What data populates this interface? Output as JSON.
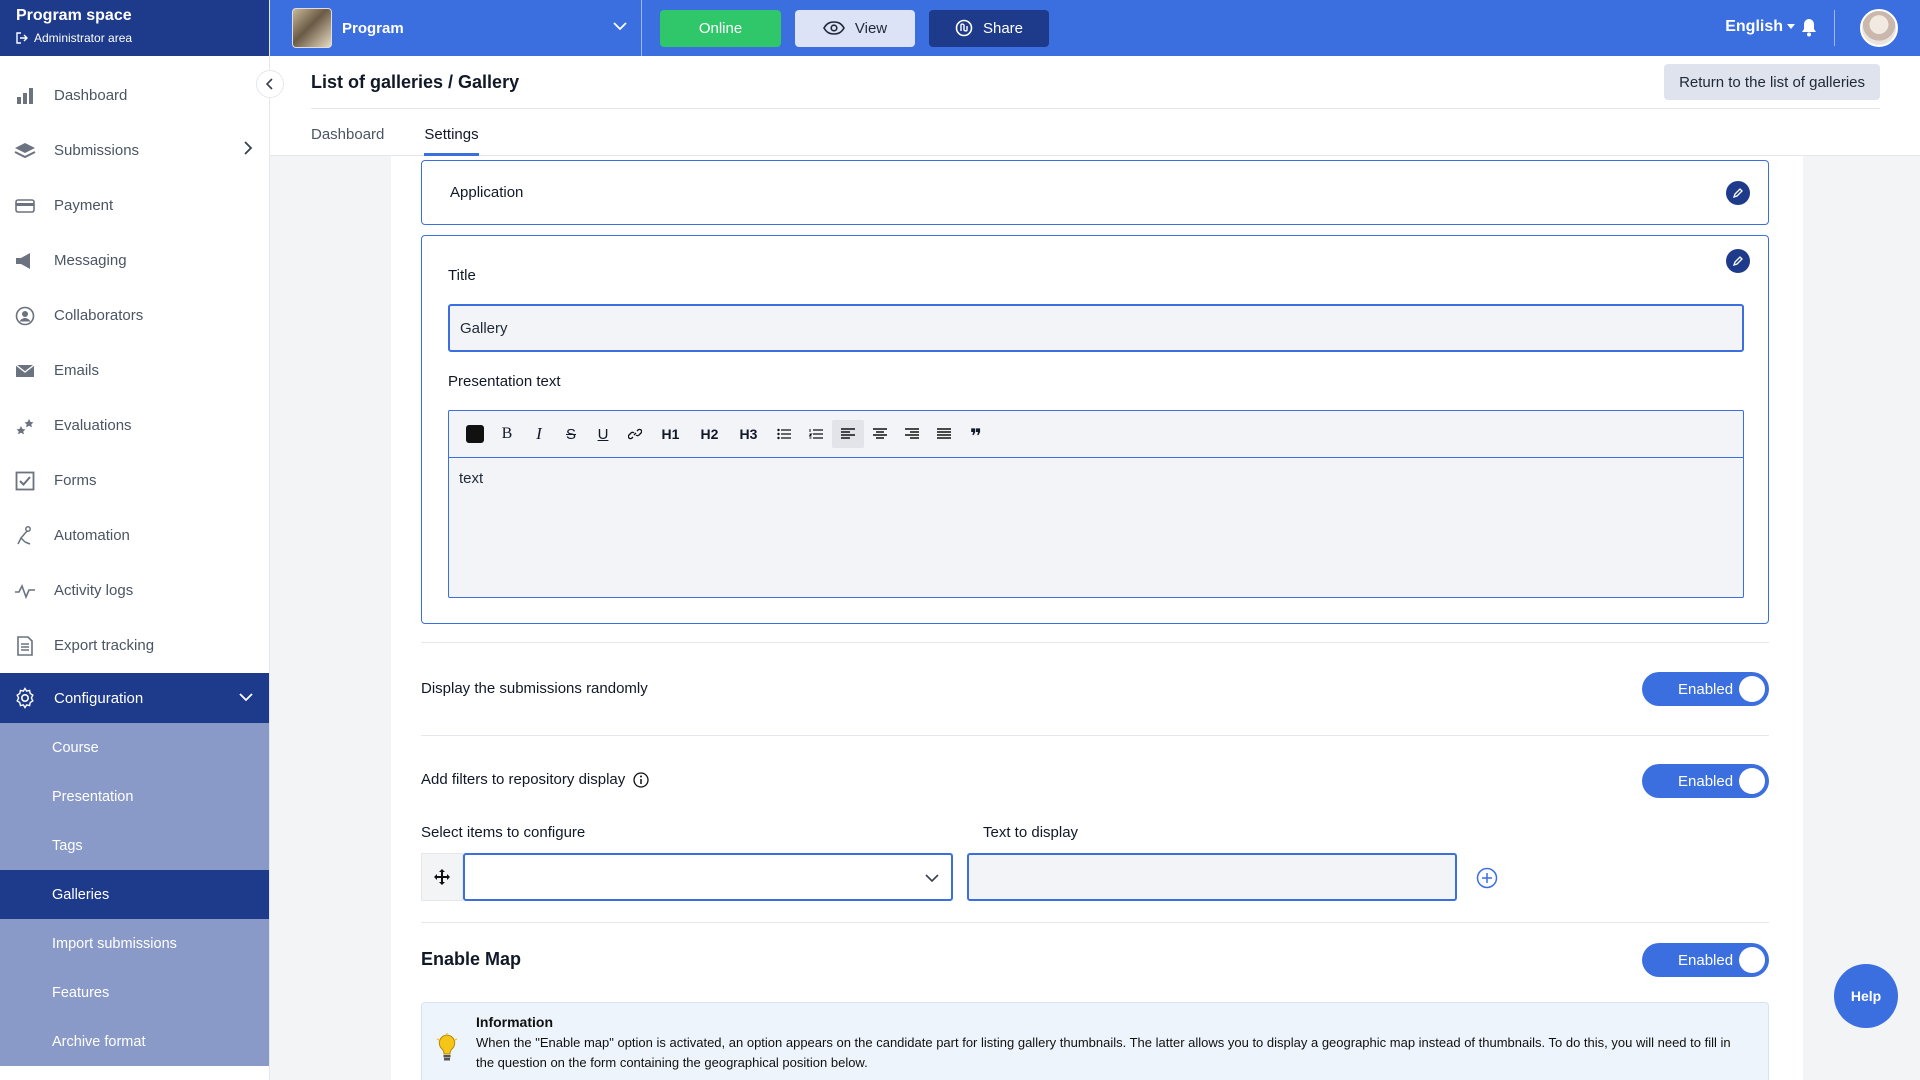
{
  "sidebar": {
    "brand_title": "Program space",
    "brand_sub": "Administrator area",
    "items": [
      {
        "label": "Dashboard",
        "icon": "bar-chart-icon"
      },
      {
        "label": "Submissions",
        "icon": "layers-icon"
      },
      {
        "label": "Payment",
        "icon": "credit-card-icon"
      },
      {
        "label": "Messaging",
        "icon": "megaphone-icon"
      },
      {
        "label": "Collaborators",
        "icon": "user-circle-icon"
      },
      {
        "label": "Emails",
        "icon": "envelope-icon"
      },
      {
        "label": "Evaluations",
        "icon": "stars-icon"
      },
      {
        "label": "Forms",
        "icon": "checkbox-icon"
      },
      {
        "label": "Automation",
        "icon": "automation-icon"
      },
      {
        "label": "Activity logs",
        "icon": "pulse-icon"
      },
      {
        "label": "Export tracking",
        "icon": "document-icon"
      },
      {
        "label": "Configuration",
        "icon": "gear-icon"
      }
    ],
    "config_sub": [
      "Course",
      "Presentation",
      "Tags",
      "Galleries",
      "Import submissions",
      "Features",
      "Archive format"
    ]
  },
  "topbar": {
    "program": "Program",
    "online": "Online",
    "view": "View",
    "share": "Share",
    "language": "English"
  },
  "header": {
    "breadcrumb": "List of galleries / Gallery",
    "return_label": "Return to the list of galleries",
    "tabs": [
      "Dashboard",
      "Settings"
    ]
  },
  "form": {
    "application_label": "Application",
    "title_label": "Title",
    "title_value": "Gallery",
    "presentation_label": "Presentation text",
    "presentation_value": "text",
    "toolbar": {
      "h1": "H1",
      "h2": "H2",
      "h3": "H3"
    },
    "random_label": "Display the submissions randomly",
    "random_state": "Enabled",
    "filters_label": "Add filters to repository display",
    "filters_state": "Enabled",
    "select_items_label": "Select items to configure",
    "text_display_label": "Text to display",
    "map_label": "Enable Map",
    "map_state": "Enabled",
    "info_title": "Information",
    "info_text": "When the \"Enable map\" option is activated, an option appears on the candidate part for listing gallery thumbnails. The latter allows you to display a geographic map instead of thumbnails. To do this, you will need to fill in the question on the form containing the geographical position below."
  },
  "help_label": "Help",
  "colors": {
    "brand": "#1e3a8a",
    "topbar": "#3b6fe0",
    "online": "#2fc76a",
    "submenu": "#8a9ac8"
  }
}
